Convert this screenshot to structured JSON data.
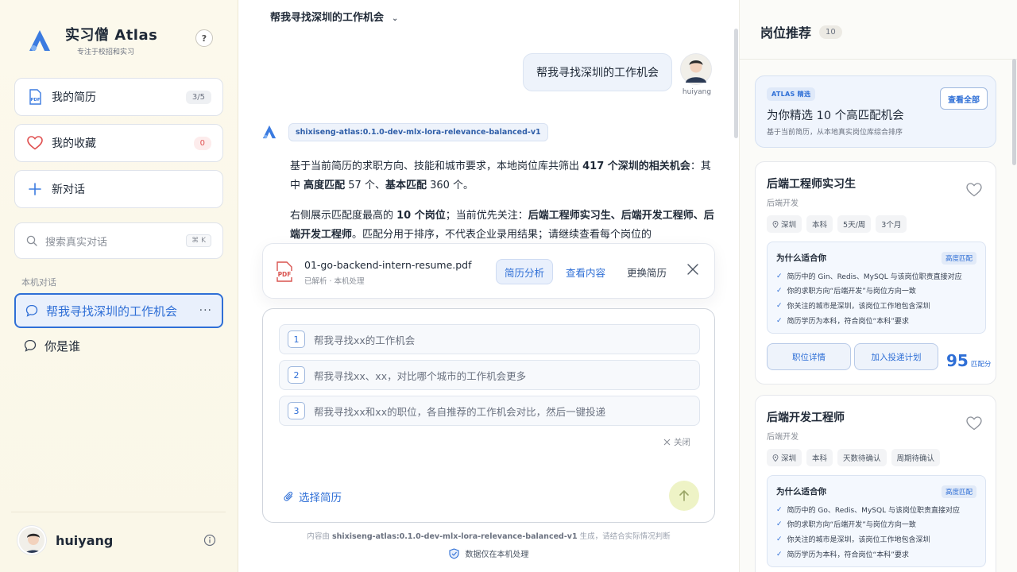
{
  "sidebar": {
    "brand_title": "实习僧 Atlas",
    "brand_sub": "专注于校招和实习",
    "help": "?",
    "resume_label": "我的简历",
    "resume_count": "3/5",
    "favorites_label": "我的收藏",
    "favorites_count": "0",
    "new_chat_label": "新对话",
    "search_placeholder": "搜索真实对话",
    "search_kbd": "⌘ K",
    "section_label": "本机对话",
    "conversations": [
      {
        "label": "帮我寻找深圳的工作机会",
        "active": true,
        "more": "···"
      },
      {
        "label": "你是谁",
        "active": false
      }
    ],
    "user_name": "huiyang"
  },
  "main": {
    "title": "帮我寻找深圳的工作机会",
    "chevron": "⌄",
    "user_message": "帮我寻找深圳的工作机会",
    "user_avatar_name": "huiyang",
    "model_tag": "shixiseng-atlas:0.1.0-dev-mlx-lora-relevance-balanced-v1",
    "para1_a": "基于当前简历的求职方向、技能和城市要求，本地岗位库共筛出 ",
    "para1_b": "417 个深圳的相关机会",
    "para1_c": "：其中 ",
    "para1_d": "高度匹配",
    "para1_e": " 57 个、",
    "para1_f": "基本匹配",
    "para1_g": " 360 个。",
    "para2_a": "右侧展示匹配度最高的 ",
    "para2_b": "10 个岗位",
    "para2_c": "；当前优先关注：",
    "para2_d": "后端工程师实习生、后端开发工程师、后端开发工程师",
    "para2_e": "。匹配分用于排序，不代表企业录用结果；请继续查看每个岗位的",
    "attachment": {
      "file_name": "01-go-backend-intern-resume.pdf",
      "file_sub": "已解析 · 本机处理",
      "btn_analyze": "简历分析",
      "btn_view": "查看内容",
      "btn_replace": "更换简历"
    },
    "suggestions": [
      {
        "num": "1",
        "text": "帮我寻找xx的工作机会"
      },
      {
        "num": "2",
        "text": "帮我寻找xx、xx，对比哪个城市的工作机会更多"
      },
      {
        "num": "3",
        "text": "帮我寻找xx和xx的职位，各自推荐的工作机会对比，然后一键投递"
      }
    ],
    "close_suggest": "关闭",
    "pick_resume": "选择简历",
    "disclaimer_a": "内容由 ",
    "disclaimer_model": "shixiseng-atlas:0.1.0-dev-mlx-lora-relevance-balanced-v1",
    "disclaimer_b": " 生成，请结合实际情况判断",
    "privacy": "数据仅在本机处理"
  },
  "rightpanel": {
    "title": "岗位推荐",
    "count": "10",
    "pick": {
      "badge": "ATLAS 精选",
      "title": "为你精选 10 个高匹配机会",
      "sub": "基于当前简历，从本地真实岗位库综合排序",
      "view_all": "查看全部"
    },
    "jobs": [
      {
        "title": "后端工程师实习生",
        "category": "后端开发",
        "tags": [
          "深圳",
          "本科",
          "5天/周",
          "3个月"
        ],
        "why_title": "为什么适合你",
        "why_badge": "高度匹配",
        "reasons": [
          "简历中的 Gin、Redis、MySQL 与该岗位职责直接对应",
          "你的求职方向“后端开发”与岗位方向一致",
          "你关注的城市是深圳，该岗位工作地包含深圳",
          "简历学历为本科，符合岗位“本科”要求"
        ],
        "btn_detail": "职位详情",
        "btn_plan": "加入投递计划",
        "score": "95",
        "score_unit": "匹配分"
      },
      {
        "title": "后端开发工程师",
        "category": "后端开发",
        "tags": [
          "深圳",
          "本科",
          "天数待确认",
          "周期待确认"
        ],
        "why_title": "为什么适合你",
        "why_badge": "高度匹配",
        "reasons": [
          "简历中的 Go、Redis、MySQL 与该岗位职责直接对应",
          "你的求职方向“后端开发”与岗位方向一致",
          "你关注的城市是深圳，该岗位工作地包含深圳",
          "简历学历为本科，符合岗位“本科”要求"
        ]
      }
    ]
  },
  "colors": {
    "accent": "#2f6fd6",
    "send_button": "#eef3c6",
    "heart_red": "#e05252"
  }
}
